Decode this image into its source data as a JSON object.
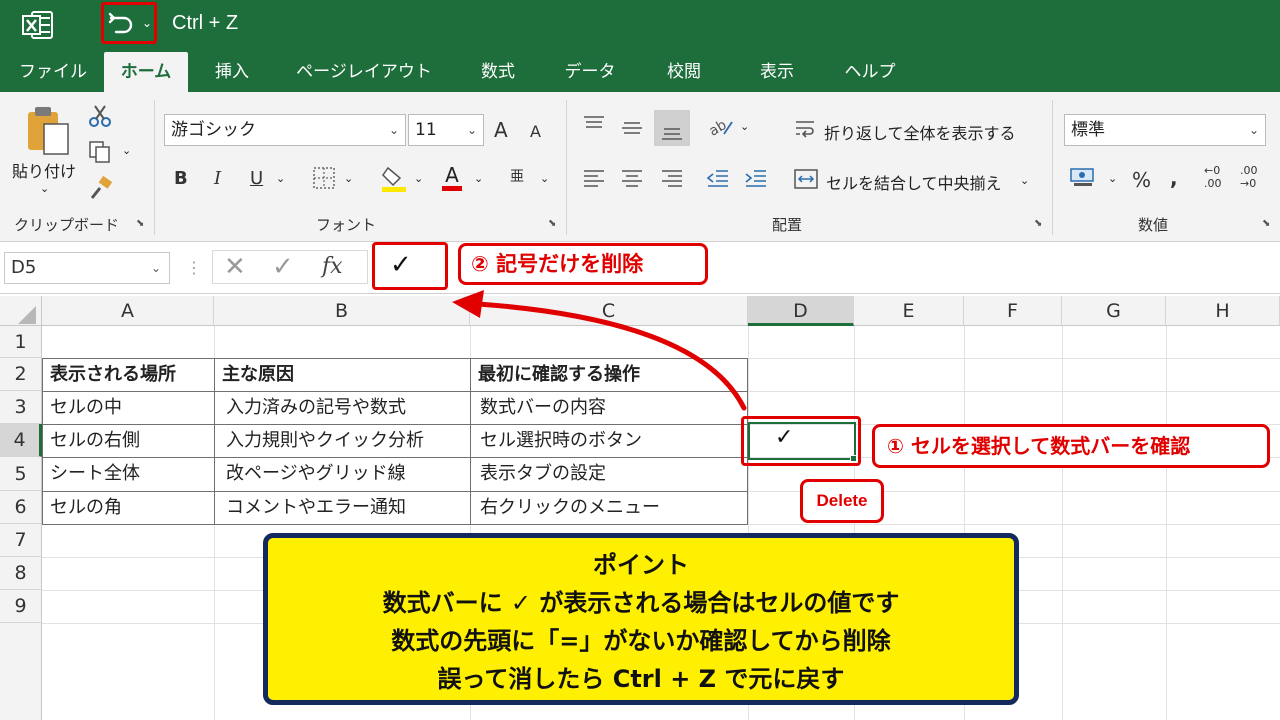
{
  "title_bar": {
    "app_icon": "excel-logo-icon",
    "undo_icon": "undo-icon",
    "title": "Ctrl + Z",
    "colors": {
      "background": "#1e6e3c",
      "highlight": "#e00000"
    }
  },
  "tabs": [
    "ファイル",
    "ホーム",
    "挿入",
    "ページレイアウト",
    "数式",
    "データ",
    "校閲",
    "表示",
    "ヘルプ"
  ],
  "active_tab": "ホーム",
  "ribbon": {
    "clipboard": {
      "paste_label": "貼り付け",
      "group_label": "クリップボード"
    },
    "font": {
      "font_name": "游ゴシック",
      "font_size": "11",
      "bold": "B",
      "italic": "I",
      "underline": "U",
      "grow": "A",
      "shrink": "A",
      "font_color": "A",
      "phonetic": "亜",
      "group_label": "フォント"
    },
    "alignment": {
      "wrap_text": "折り返して全体を表示する",
      "merge_center": "セルを結合して中央揃え",
      "group_label": "配置"
    },
    "number": {
      "format": "標準",
      "percent": "%",
      "comma": "9",
      "inc_decimal": ".00",
      "dec_decimal": ".00",
      "inc_small": "←0",
      "dec_small": "→0",
      "group_label": "数値"
    }
  },
  "formula_bar": {
    "name_box": "D5",
    "cancel": "✕",
    "enter": "✓",
    "fx": "fx",
    "value": "✓"
  },
  "callouts": {
    "step2": "② 記号だけを削除",
    "step1": "① セルを選択して数式バーを確認",
    "delete_key": "Delete"
  },
  "grid": {
    "columns": [
      "A",
      "B",
      "C",
      "D",
      "E",
      "F",
      "G",
      "H"
    ],
    "selected_column": "D",
    "rows": [
      "1",
      "2",
      "3",
      "4",
      "5",
      "6",
      "7",
      "8",
      "9"
    ],
    "selected_row": "4",
    "table": {
      "headers": [
        "表示される場所",
        "主な原因",
        "最初に確認する操作"
      ],
      "rows": [
        [
          "セルの中",
          "入力済みの記号や数式",
          "数式バーの内容"
        ],
        [
          "セルの右側",
          "入力規則やクイック分析",
          "セル選択時のボタン"
        ],
        [
          "シート全体",
          "改ページやグリッド線",
          "表示タブの設定"
        ],
        [
          "セルの角",
          "コメントやエラー通知",
          "右クリックのメニュー"
        ]
      ]
    },
    "active_cell_value": "✓"
  },
  "note": {
    "title": "ポイント",
    "line1": "数式バーに ✓ が表示される場合はセルの値です",
    "line2": "数式の先頭に「=」がないか確認してから削除",
    "line3": "誤って消したら Ctrl + Z で元に戻す",
    "colors": {
      "background": "#ffef00",
      "border": "#142a5e"
    }
  }
}
